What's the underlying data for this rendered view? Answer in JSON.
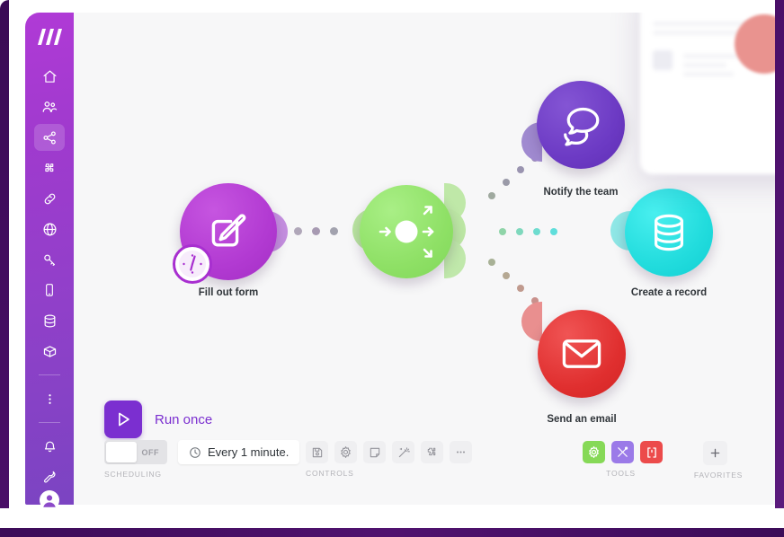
{
  "app": {
    "name": "Make scenario editor",
    "logo_icon": "make-logo-icon"
  },
  "sidebar": {
    "items": [
      {
        "id": "home",
        "label": "Home",
        "icon": "home-icon",
        "active": false
      },
      {
        "id": "team",
        "label": "Team",
        "icon": "users-icon",
        "active": false
      },
      {
        "id": "scenarios",
        "label": "Scenarios",
        "icon": "share-nodes-icon",
        "active": true
      },
      {
        "id": "templates",
        "label": "Templates",
        "icon": "puzzle-icon",
        "active": false
      },
      {
        "id": "connections",
        "label": "Connections",
        "icon": "link-icon",
        "active": false
      },
      {
        "id": "webhooks",
        "label": "Webhooks",
        "icon": "globe-icon",
        "active": false
      },
      {
        "id": "keys",
        "label": "Keys",
        "icon": "key-icon",
        "active": false
      },
      {
        "id": "devices",
        "label": "Devices",
        "icon": "mobile-icon",
        "active": false
      },
      {
        "id": "datastores",
        "label": "Data stores",
        "icon": "database-icon",
        "active": false
      },
      {
        "id": "datastructures",
        "label": "Data structures",
        "icon": "box-icon",
        "active": false
      },
      {
        "id": "more",
        "label": "More",
        "icon": "dots-vertical-icon",
        "active": false
      },
      {
        "id": "notifications",
        "label": "Notifications",
        "icon": "bell-icon",
        "active": false
      },
      {
        "id": "help",
        "label": "Help",
        "icon": "wrench-icon",
        "active": false
      }
    ],
    "avatar_label": "Account avatar",
    "bg_color": "#a03ace"
  },
  "scenario": {
    "nodes": [
      {
        "id": "trigger",
        "label": "Fill out form",
        "icon": "form-edit-icon",
        "color": "#b83ad6",
        "badge": "clock-icon"
      },
      {
        "id": "router",
        "label": "",
        "icon": "router-arrows-icon",
        "color": "#8ede6a",
        "badge": null
      },
      {
        "id": "notify",
        "label": "Notify the team",
        "icon": "chat-bubbles-icon",
        "color": "#6b38c4",
        "badge": null
      },
      {
        "id": "record",
        "label": "Create a record",
        "icon": "database-icon",
        "color": "#1fd9da",
        "badge": null
      },
      {
        "id": "email",
        "label": "Send an email",
        "icon": "envelope-icon",
        "color": "#e13b3b",
        "badge": null
      }
    ]
  },
  "toolbar": {
    "run_label": "Run once",
    "run_icon": "play-icon",
    "scheduling": {
      "caption": "SCHEDULING",
      "toggle_state": "OFF",
      "interval_text": "Every 1 minute.",
      "interval_icon": "clock-icon"
    },
    "controls": {
      "caption": "CONTROLS",
      "buttons": [
        {
          "id": "save",
          "label": "Save",
          "icon": "save-icon"
        },
        {
          "id": "settings",
          "label": "Settings",
          "icon": "gear-icon"
        },
        {
          "id": "notes",
          "label": "Notes",
          "icon": "note-icon"
        },
        {
          "id": "autoalign",
          "label": "Auto-align",
          "icon": "magic-wand-icon"
        },
        {
          "id": "addmodule",
          "label": "Add another module",
          "icon": "puzzle-plus-icon"
        },
        {
          "id": "more",
          "label": "More",
          "icon": "ellipsis-icon"
        }
      ]
    },
    "tools": {
      "caption": "TOOLS",
      "buttons": [
        {
          "id": "tools",
          "label": "Tools",
          "icon": "gear-icon",
          "color": "#86d957"
        },
        {
          "id": "flowcontrol",
          "label": "Flow control",
          "icon": "tools-cross-icon",
          "color": "#9b7ae8"
        },
        {
          "id": "text",
          "label": "Text parser",
          "icon": "brackets-icon",
          "color": "#ec4b4b"
        }
      ]
    },
    "favorites": {
      "caption": "FAVORITES",
      "add_label": "Add",
      "add_icon": "plus-icon"
    }
  }
}
